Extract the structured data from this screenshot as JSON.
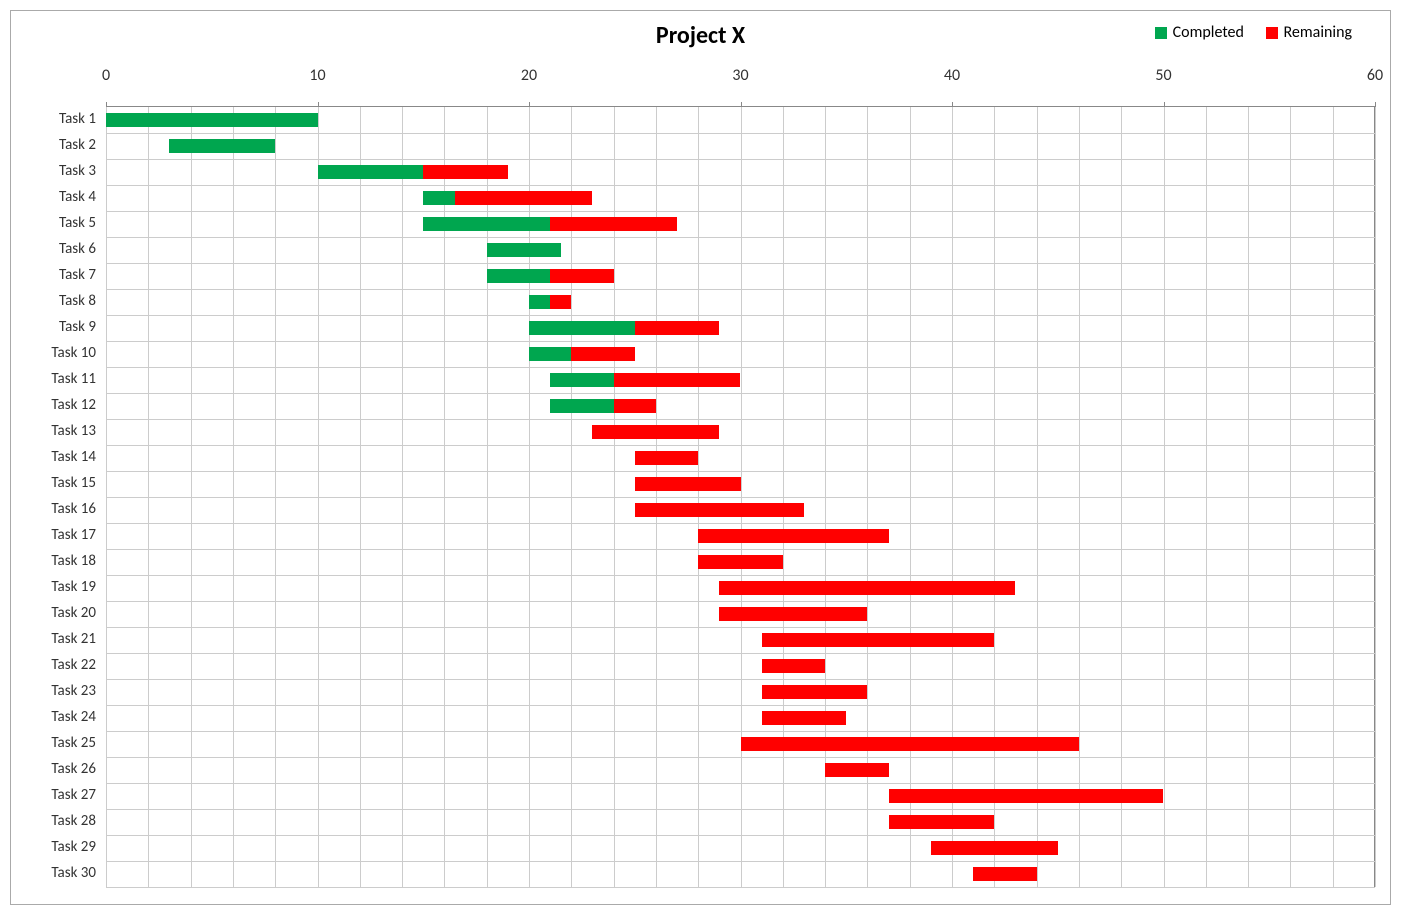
{
  "chart_data": {
    "type": "bar",
    "title": "Project X",
    "orientation": "horizontal",
    "stacked": true,
    "xlabel": "",
    "ylabel": "",
    "xlim": [
      0,
      60
    ],
    "x_ticks": [
      0,
      10,
      20,
      30,
      40,
      50,
      60
    ],
    "legend": [
      "Completed",
      "Remaining"
    ],
    "legend_position": "top-right",
    "series_colors": {
      "Completed": "#00a64f",
      "Remaining": "#ff0000"
    },
    "categories": [
      "Task 1",
      "Task 2",
      "Task 3",
      "Task 4",
      "Task 5",
      "Task 6",
      "Task 7",
      "Task 8",
      "Task 9",
      "Task 10",
      "Task 11",
      "Task 12",
      "Task 13",
      "Task 14",
      "Task 15",
      "Task 16",
      "Task 17",
      "Task 18",
      "Task 19",
      "Task 20",
      "Task 21",
      "Task 22",
      "Task 23",
      "Task 24",
      "Task 25",
      "Task 26",
      "Task 27",
      "Task 28",
      "Task 29",
      "Task 30"
    ],
    "start": [
      0,
      3,
      10,
      15,
      15,
      18,
      18,
      20,
      20,
      20,
      21,
      21,
      23,
      25,
      25,
      25,
      28,
      28,
      29,
      29,
      31,
      31,
      31,
      31,
      30,
      34,
      37,
      37,
      39,
      41
    ],
    "series": [
      {
        "name": "Completed",
        "values": [
          10,
          5,
          5,
          1.5,
          6,
          3.5,
          3,
          1,
          5,
          2,
          3,
          3,
          0,
          0,
          0,
          0,
          0,
          0,
          0,
          0,
          0,
          0,
          0,
          0,
          0,
          0,
          0,
          0,
          0,
          0
        ]
      },
      {
        "name": "Remaining",
        "values": [
          0,
          0,
          4,
          6.5,
          6,
          0,
          3,
          1,
          4,
          3,
          6,
          2,
          6,
          3,
          5,
          8,
          9,
          4,
          14,
          7,
          11,
          3,
          5,
          4,
          16,
          3,
          13,
          5,
          6,
          3
        ]
      }
    ]
  }
}
